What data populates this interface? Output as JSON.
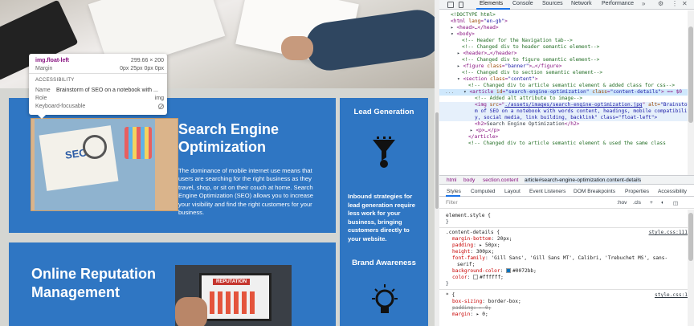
{
  "page": {
    "seo_title": "Search Engine Optimization",
    "seo_text": "The dominance of mobile internet use means that users are searching for the right business as they travel, shop, or sit on their couch at home. Search Engine Optimization (SEO) allows you to increase your visibility and find the right customers for your business.",
    "seo_image_word": "SEO",
    "side_heading_1": "Lead Generation",
    "side_text": "Inbound strategies for lead generation require less work for your business, bringing customers directly to your website.",
    "side_heading_2": "Brand Awareness",
    "orm_title": "Online Reputation Management",
    "rep_image_label": "REPUTATION"
  },
  "tooltip": {
    "selector": "img.float-left",
    "size": "299.66 × 200",
    "margin_label": "Margin",
    "margin_value": "0px 25px 0px 0px",
    "accessibility_header": "ACCESSIBILITY",
    "name_label": "Name",
    "name_value": "Brainstorm of SEO on a notebook with ...",
    "role_label": "Role",
    "role_value": "img",
    "keyboard_label": "Keyboard-focusable"
  },
  "devtools": {
    "tabs": [
      "Elements",
      "Console",
      "Sources",
      "Network",
      "Performance"
    ],
    "active_tab": "Elements",
    "more": "»",
    "breadcrumbs": [
      "html",
      "body",
      "section.content",
      "article#search-engine-optimization.content-details"
    ],
    "subtabs": [
      "Styles",
      "Computed",
      "Layout",
      "Event Listeners",
      "DOM Breakpoints",
      "Properties",
      "Accessibility"
    ],
    "filter_placeholder": "Filter",
    "filter_hov": ":hov",
    "filter_cls": ".cls",
    "filter_plus": "+",
    "gutter": "...",
    "dom": {
      "l1": "<!DOCTYPE html>",
      "l2_tag": "<html ",
      "l2_attr": "lang",
      "l2_val": "\"en-gb\"",
      "l2_end": ">",
      "l3": "<head>…</head>",
      "l4": "<body>",
      "l5": "<!-- Header for the Navigation tab-->",
      "l6": "<!-- Changed div to header semantic element-->",
      "l7": "<header>…</header>",
      "l8": "<!-- Changed div to figure semantic element-->",
      "l9_tag": "<figure ",
      "l9_attr": "class",
      "l9_val": "\"banner\"",
      "l9_end": ">…</figure>",
      "l10": "<!-- Changed div to section semantic element-->",
      "l11_tag": "<section ",
      "l11_attr": "class",
      "l11_val": "\"content\"",
      "l11_end": ">",
      "l12": "<!-- Changed div to article semantic element & added class for css-->",
      "l13_tag": "<article ",
      "l13_attr1": "id",
      "l13_val1": "\"search-engine-optimization\"",
      "l13_attr2": "class",
      "l13_val2": "\"content-details\"",
      "l13_end": "> == $0",
      "l14": "<!-- Added alt attribute to image-->",
      "l15_tag": "<img ",
      "l15_attr": "src",
      "l15_val": "./assets/images/search-engine-optimization.jpg",
      "l15_attr2": " alt=",
      "l15_val2": "\"Brainstor",
      "l16": "m of SEO on a notebook with words content, headings, mobile compatibilit",
      "l17": "y, social media, link building, backlink\" class=\"float-left\">",
      "l18_tag": "<h2>",
      "l18_text": "Search Engine Optimization",
      "l18_end": "</h2>",
      "l19": "<p>…</p>",
      "l20": "</article>",
      "l21": "<!-- Changed div to article semantic element & used the same class"
    },
    "styles": {
      "element_style": "element.style {",
      "close": "}",
      "rule1_selector": ".content-details {",
      "rule1_source": "style.css:111",
      "props": [
        {
          "name": "margin-bottom",
          "value": "20px;"
        },
        {
          "name": "padding",
          "value": "▸ 50px;"
        },
        {
          "name": "height",
          "value": "300px;"
        },
        {
          "name": "font-family",
          "value": "'Gill Sans', 'Gill Sans MT', Calibri, 'Trebuchet MS', sans-"
        },
        {
          "name": "",
          "value": "serif;"
        },
        {
          "name": "background-color",
          "value": "#0072bb;"
        },
        {
          "name": "color",
          "value": "#ffffff;"
        }
      ],
      "rule2_selector": "* {",
      "rule2_source": "style.css:1",
      "rule2_props": [
        {
          "name": "box-sizing",
          "value": "border-box;"
        },
        {
          "name": "padding",
          "value": "▸ 0;"
        },
        {
          "name": "margin",
          "value": "▸ 0;"
        }
      ]
    }
  },
  "colors": {
    "content_bg": "#2f76c3",
    "swatch_bg": "#0072bb",
    "swatch_color": "#ffffff",
    "accent": "#1a73e8"
  }
}
